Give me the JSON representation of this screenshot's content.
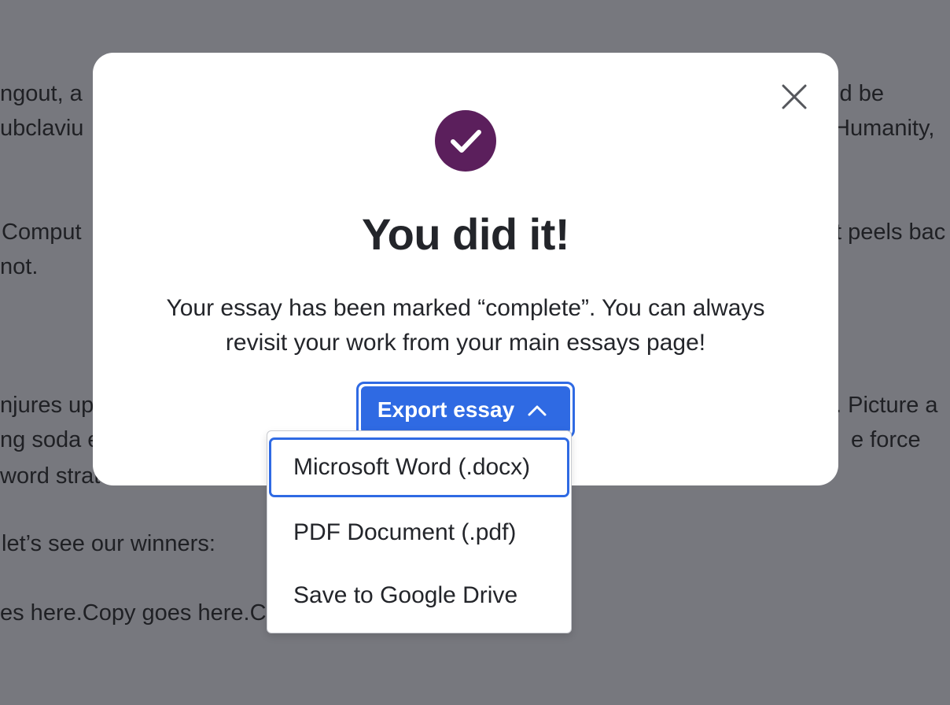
{
  "background_text": [
    "ngout, a",
    "'d be",
    "ubclaviu",
    "Humanity,",
    "Comput",
    "t peels bac",
    "not.",
    "njures up",
    ". Picture a",
    "ng soda e",
    "e force",
    "word strat",
    "let’s see our winners:",
    "es here.Copy goes here.C"
  ],
  "modal": {
    "title": "You did it!",
    "message": "Your essay has been marked “complete”. You can always revisit your work from your main essays page!",
    "icons": {
      "success": "check-circle-icon",
      "close": "close-icon",
      "export_chevron": "chevron-up-icon"
    },
    "colors": {
      "success_circle": "#5b1f5c",
      "primary": "#2f6ae3"
    }
  },
  "export": {
    "button_label": "Export essay",
    "menu": [
      "Microsoft Word (.docx)",
      "PDF Document (.pdf)",
      "Save to Google Drive"
    ]
  }
}
